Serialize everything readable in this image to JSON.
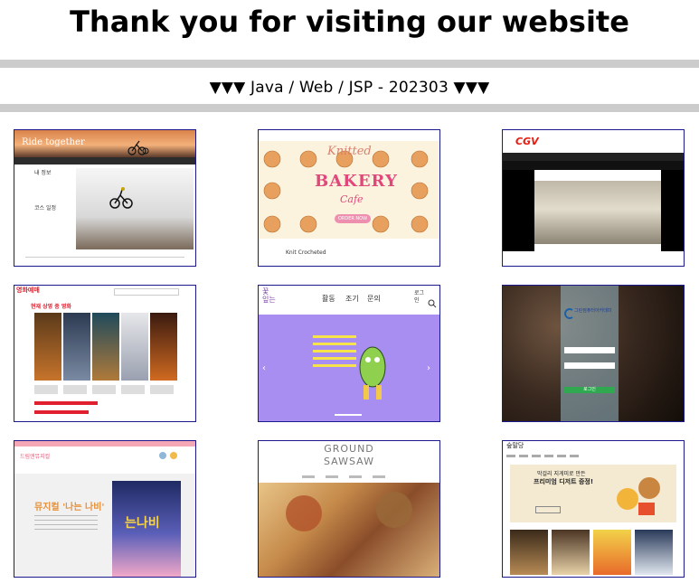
{
  "page": {
    "title": "Thank you for visiting our website",
    "subtitle": "▼▼▼ Java / Web / JSP - 202303 ▼▼▼"
  },
  "thumbnails": [
    {
      "brand": "Ride together",
      "menu_a": "내 정보",
      "menu_b": "코스 일정"
    },
    {
      "brand_top": "Knitted",
      "brand_mid": "BAKERY",
      "brand_bot": "Cafe",
      "cta": "ORDER NOW",
      "caption": "Knit Crocheted"
    },
    {
      "brand": "CGV"
    },
    {
      "brand": "영화예매",
      "headline": "현재 상영 중 영화"
    },
    {
      "logo": "꽃\n잎는",
      "nav": [
        "활동",
        "조기",
        "문의"
      ],
      "login": "로그\n인"
    },
    {
      "brand": "그린컴퓨터아카데미",
      "button": "로그인"
    },
    {
      "brand": "드림앤뮤지컬",
      "headline": "뮤지컬 '나는 나비'",
      "poster": "는나비"
    },
    {
      "brand_top": "GROUND",
      "brand_bot": "SAWSAW"
    },
    {
      "brand": "숲말당",
      "headline_a": "막걸리 지게미로 만든",
      "headline_b": "프리미엄 디저트 증정!"
    }
  ]
}
